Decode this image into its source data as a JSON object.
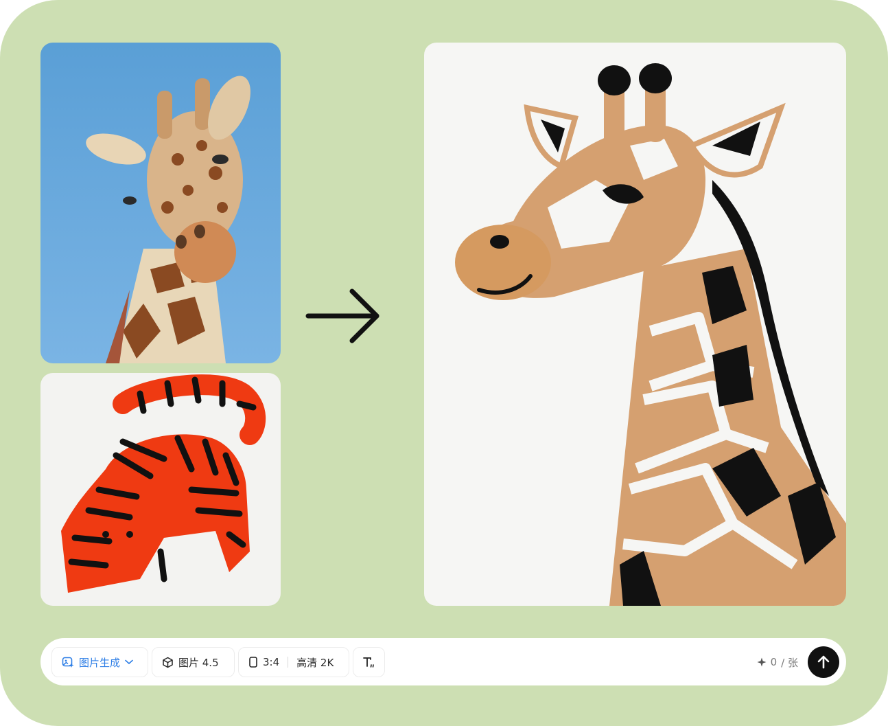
{
  "images": {
    "source_photo": "giraffe-photo",
    "style_reference": "tiger-illustration",
    "result": "giraffe-illustration"
  },
  "toolbar": {
    "mode_label": "图片生成",
    "model_label": "图片 4.5",
    "aspect_ratio": "3:4",
    "resolution": "高清 2K",
    "credits_count": "0",
    "credits_unit": "/ 张"
  },
  "icons": {
    "mode": "image-sparkle-icon",
    "mode_dropdown": "chevron-down-icon",
    "model": "cube-icon",
    "aspect": "portrait-frame-icon",
    "text_style": "text-style-icon",
    "credits": "sparkle-icon",
    "send": "arrow-up-icon"
  },
  "colors": {
    "background": "#cddfb3",
    "accent": "#2f7fe6",
    "send_button": "#111111"
  }
}
